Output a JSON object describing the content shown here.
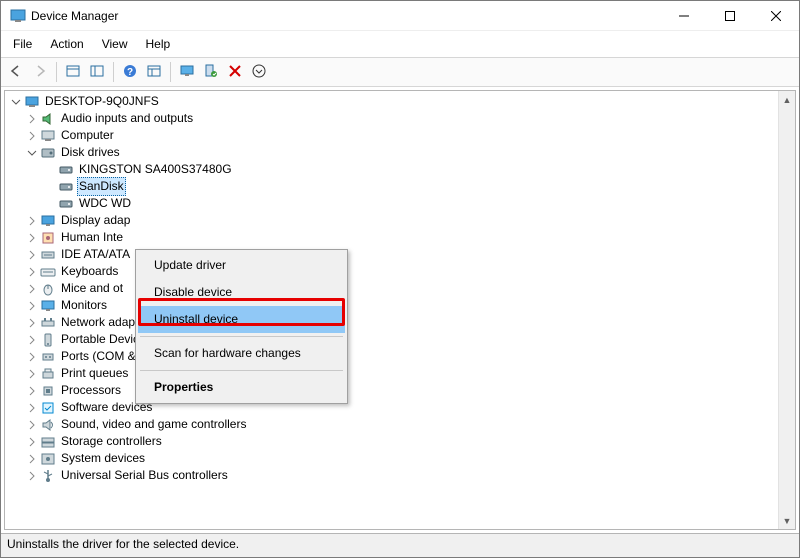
{
  "window": {
    "title": "Device Manager"
  },
  "menu": {
    "file": "File",
    "action": "Action",
    "view": "View",
    "help": "Help"
  },
  "toolbar": {
    "back": "back",
    "forward": "forward",
    "show_hidden": "show-hidden",
    "pane1": "pane1",
    "help": "help",
    "pane2": "pane2",
    "monitor": "monitor",
    "scan": "scan",
    "remove": "remove",
    "extra": "extra"
  },
  "tree": {
    "root": "DESKTOP-9Q0JNFS",
    "nodes": [
      {
        "label": "Audio inputs and outputs",
        "icon": "audio",
        "expanded": false
      },
      {
        "label": "Computer",
        "icon": "computer",
        "expanded": false
      },
      {
        "label": "Disk drives",
        "icon": "disk",
        "expanded": true,
        "children": [
          {
            "label": "KINGSTON SA400S37480G",
            "icon": "drive"
          },
          {
            "label": "SanDisk",
            "icon": "drive",
            "selected": true
          },
          {
            "label": "WDC WD",
            "icon": "drive"
          }
        ]
      },
      {
        "label": "Display adap",
        "icon": "display",
        "expanded": false,
        "truncated": true
      },
      {
        "label": "Human Inte",
        "icon": "hid",
        "expanded": false,
        "truncated": true
      },
      {
        "label": "IDE ATA/ATA",
        "icon": "ide",
        "expanded": false,
        "truncated": true
      },
      {
        "label": "Keyboards",
        "icon": "keyboard",
        "expanded": false
      },
      {
        "label": "Mice and ot",
        "icon": "mouse",
        "expanded": false,
        "truncated": true
      },
      {
        "label": "Monitors",
        "icon": "monitor",
        "expanded": false
      },
      {
        "label": "Network adapters",
        "icon": "network",
        "expanded": false
      },
      {
        "label": "Portable Devices",
        "icon": "portable",
        "expanded": false
      },
      {
        "label": "Ports (COM & LPT)",
        "icon": "ports",
        "expanded": false
      },
      {
        "label": "Print queues",
        "icon": "printer",
        "expanded": false
      },
      {
        "label": "Processors",
        "icon": "cpu",
        "expanded": false
      },
      {
        "label": "Software devices",
        "icon": "software",
        "expanded": false
      },
      {
        "label": "Sound, video and game controllers",
        "icon": "sound",
        "expanded": false
      },
      {
        "label": "Storage controllers",
        "icon": "storage",
        "expanded": false
      },
      {
        "label": "System devices",
        "icon": "system",
        "expanded": false
      },
      {
        "label": "Universal Serial Bus controllers",
        "icon": "usb",
        "expanded": false
      }
    ]
  },
  "context_menu": {
    "update": "Update driver",
    "disable": "Disable device",
    "uninstall": "Uninstall device",
    "scan": "Scan for hardware changes",
    "properties": "Properties",
    "hovered": "uninstall"
  },
  "status": {
    "text": "Uninstalls the driver for the selected device."
  }
}
